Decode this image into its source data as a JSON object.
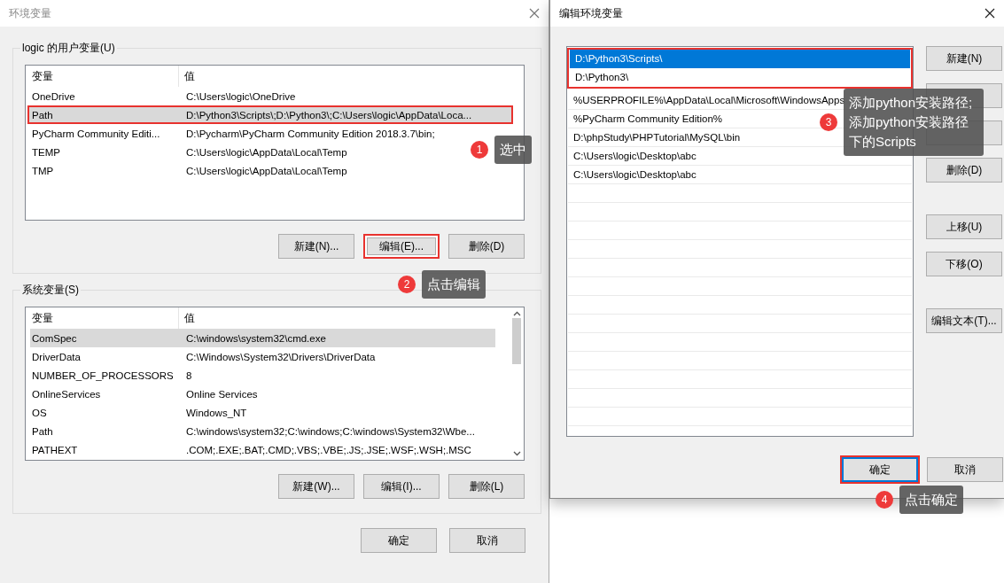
{
  "env_window": {
    "title": "环境变量",
    "user_group": {
      "label": "logic 的用户变量(U)",
      "columns": [
        "变量",
        "值"
      ],
      "rows": [
        {
          "name": "OneDrive",
          "value": "C:\\Users\\logic\\OneDrive",
          "selected": false,
          "highlighted": false
        },
        {
          "name": "Path",
          "value": "D:\\Python3\\Scripts\\;D:\\Python3\\;C:\\Users\\logic\\AppData\\Loca...",
          "selected": true,
          "highlighted": true
        },
        {
          "name": "PyCharm Community Editi...",
          "value": "D:\\Pycharm\\PyCharm Community Edition 2018.3.7\\bin;",
          "selected": false,
          "highlighted": false
        },
        {
          "name": "TEMP",
          "value": "C:\\Users\\logic\\AppData\\Local\\Temp",
          "selected": false,
          "highlighted": false
        },
        {
          "name": "TMP",
          "value": "C:\\Users\\logic\\AppData\\Local\\Temp",
          "selected": false,
          "highlighted": false
        }
      ],
      "buttons": [
        {
          "label": "新建(N)...",
          "highlighted": false
        },
        {
          "label": "编辑(E)...",
          "highlighted": true
        },
        {
          "label": "删除(D)",
          "highlighted": false
        }
      ]
    },
    "system_group": {
      "label": "系统变量(S)",
      "columns": [
        "变量",
        "值"
      ],
      "rows": [
        {
          "name": "ComSpec",
          "value": "C:\\windows\\system32\\cmd.exe",
          "selected": true,
          "highlighted": false
        },
        {
          "name": "DriverData",
          "value": "C:\\Windows\\System32\\Drivers\\DriverData",
          "selected": false,
          "highlighted": false
        },
        {
          "name": "NUMBER_OF_PROCESSORS",
          "value": "8",
          "selected": false,
          "highlighted": false
        },
        {
          "name": "OnlineServices",
          "value": "Online Services",
          "selected": false,
          "highlighted": false
        },
        {
          "name": "OS",
          "value": "Windows_NT",
          "selected": false,
          "highlighted": false
        },
        {
          "name": "Path",
          "value": "C:\\windows\\system32;C:\\windows;C:\\windows\\System32\\Wbe...",
          "selected": false,
          "highlighted": false
        },
        {
          "name": "PATHEXT",
          "value": ".COM;.EXE;.BAT;.CMD;.VBS;.VBE;.JS;.JSE;.WSF;.WSH;.MSC",
          "selected": false,
          "highlighted": false
        }
      ],
      "buttons": [
        {
          "label": "新建(W)...",
          "highlighted": false
        },
        {
          "label": "编辑(I)...",
          "highlighted": false
        },
        {
          "label": "删除(L)",
          "highlighted": false
        }
      ]
    },
    "buttons": [
      {
        "label": "确定"
      },
      {
        "label": "取消"
      }
    ]
  },
  "edit_window": {
    "title": "编辑环境变量",
    "entries": [
      {
        "text": "D:\\Python3\\Scripts\\",
        "selected": true,
        "highlighted": true
      },
      {
        "text": "D:\\Python3\\",
        "selected": false,
        "highlighted": true
      },
      {
        "text": "%USERPROFILE%\\AppData\\Local\\Microsoft\\WindowsApps",
        "selected": false,
        "highlighted": false
      },
      {
        "text": "%PyCharm Community Edition%",
        "selected": false,
        "highlighted": false
      },
      {
        "text": "D:\\phpStudy\\PHPTutorial\\MySQL\\bin",
        "selected": false,
        "highlighted": false
      },
      {
        "text": "C:\\Users\\logic\\Desktop\\abc",
        "selected": false,
        "highlighted": false
      },
      {
        "text": "C:\\Users\\logic\\Desktop\\abc",
        "selected": false,
        "highlighted": false
      }
    ],
    "side_button_groups": [
      [
        {
          "kind": "labeled",
          "label": "新建(N)"
        },
        {
          "kind": "covered"
        },
        {
          "kind": "covered"
        },
        {
          "kind": "labeled",
          "label": "删除(D)"
        }
      ],
      [
        {
          "kind": "labeled",
          "label": "上移(U)"
        },
        {
          "kind": "labeled",
          "label": "下移(O)"
        }
      ],
      [
        {
          "kind": "labeled",
          "label": "编辑文本(T)..."
        }
      ]
    ],
    "buttons": [
      {
        "label": "确定",
        "focused": true,
        "highlighted": true
      },
      {
        "label": "取消",
        "focused": false,
        "highlighted": false
      }
    ]
  },
  "callouts": [
    {
      "number": "1",
      "text": "选中"
    },
    {
      "number": "2",
      "text": "点击编辑"
    },
    {
      "number": "3",
      "lines": [
        "添加python安装路径;",
        "添加python安装路径下的Scripts"
      ]
    },
    {
      "number": "4",
      "text": "点击确定"
    }
  ]
}
